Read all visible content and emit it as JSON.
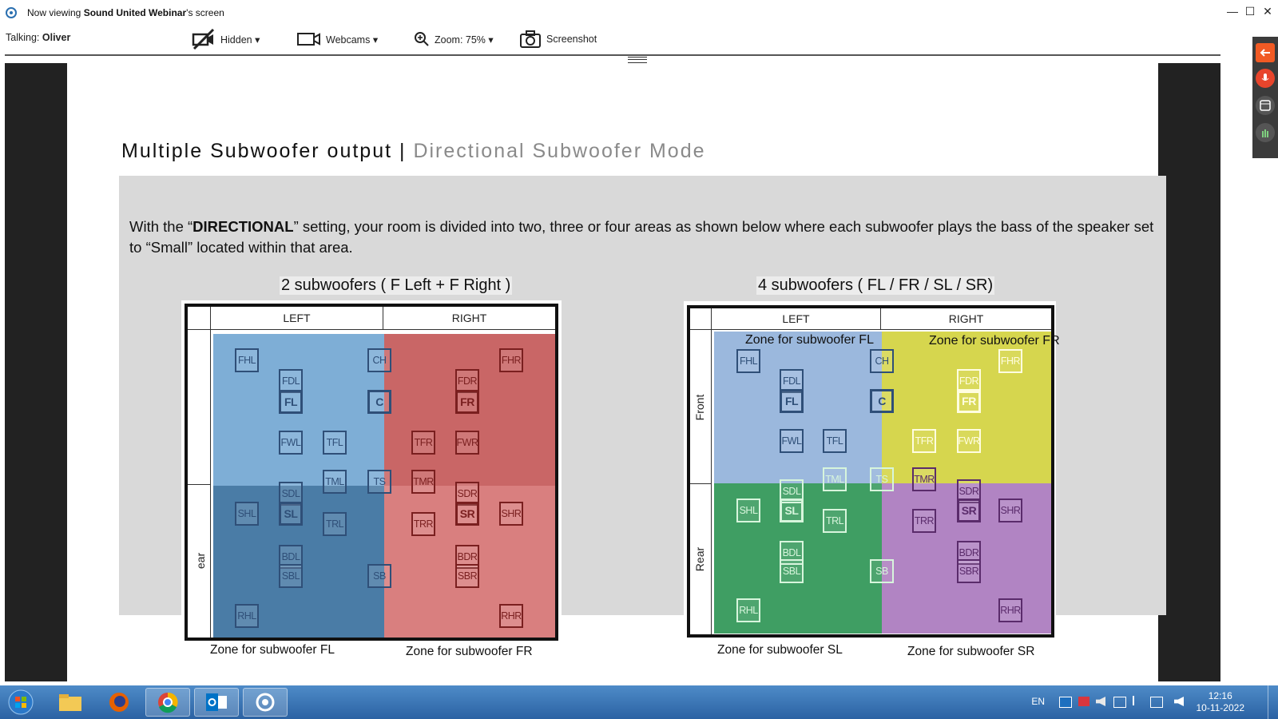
{
  "titlebar": {
    "prefix": "Now viewing ",
    "host": "Sound United Webinar",
    "suffix": "'s screen",
    "minimize": "—",
    "maximize": "☐",
    "close": "✕"
  },
  "toolbar": {
    "talking_label": "Talking:",
    "talking_name": "Oliver",
    "hidden_label": "Hidden ▾",
    "webcams_label": "Webcams ▾",
    "zoom_label": "Zoom: 75% ▾",
    "screenshot_label": "Screenshot"
  },
  "slide": {
    "title_main": "Multiple Subwoofer output | ",
    "title_sub": "Directional Subwoofer Mode",
    "para_prefix": "With the “",
    "para_bold": "DIRECTIONAL",
    "para_suffix": "” setting, your room is divided into two, three or four areas as shown below where each subwoofer plays the bass of the speaker set to “Small” located within that area.",
    "diagram1": {
      "title": "2 subwoofers ( F Left + F Right )",
      "left_header": "LEFT",
      "right_header": "RIGHT",
      "side_label": "ear",
      "zone_fl": "Zone for subwoofer FL",
      "zone_fr": "Zone for subwoofer FR"
    },
    "diagram2": {
      "title": "4 subwoofers ( FL / FR / SL / SR)",
      "left_header": "LEFT",
      "right_header": "RIGHT",
      "front_label": "Front",
      "rear_label": "Rear",
      "zone_fl": "Zone for subwoofer FL",
      "zone_fr": "Zone for subwoofer FR",
      "zone_sl": "Zone for subwoofer SL",
      "zone_sr": "Zone for subwoofer SR"
    },
    "speakers": {
      "FHL": "FHL",
      "CH": "CH",
      "FHR": "FHR",
      "FDL": "FDL",
      "FDR": "FDR",
      "FL": "FL",
      "C": "C",
      "FR": "FR",
      "FWL": "FWL",
      "TFL": "TFL",
      "TFR": "TFR",
      "FWR": "FWR",
      "TML": "TML",
      "TS": "TS",
      "TMR": "TMR",
      "SDL": "SDL",
      "SDR": "SDR",
      "SHL": "SHL",
      "SL": "SL",
      "TRL": "TRL",
      "TRR": "TRR",
      "SR": "SR",
      "SHR": "SHR",
      "BDL": "BDL",
      "BDR": "BDR",
      "SBL": "SBL",
      "SB": "SB",
      "SBR": "SBR",
      "RHL": "RHL",
      "RHR": "RHR"
    }
  },
  "colors": {
    "zone_blue": "#7eaed6",
    "zone_darkblue": "#4a7ca6",
    "zone_red": "#c96666",
    "zone_salmon": "#d97f7f",
    "zone_lightblue": "#9bb8dd",
    "zone_yellow": "#d6d64e",
    "zone_green": "#3f9e63",
    "zone_purple": "#b184c3",
    "taskbar": "#2b62a3"
  },
  "taskbar": {
    "lang": "EN",
    "time": "12:16",
    "date": "10-11-2022"
  }
}
